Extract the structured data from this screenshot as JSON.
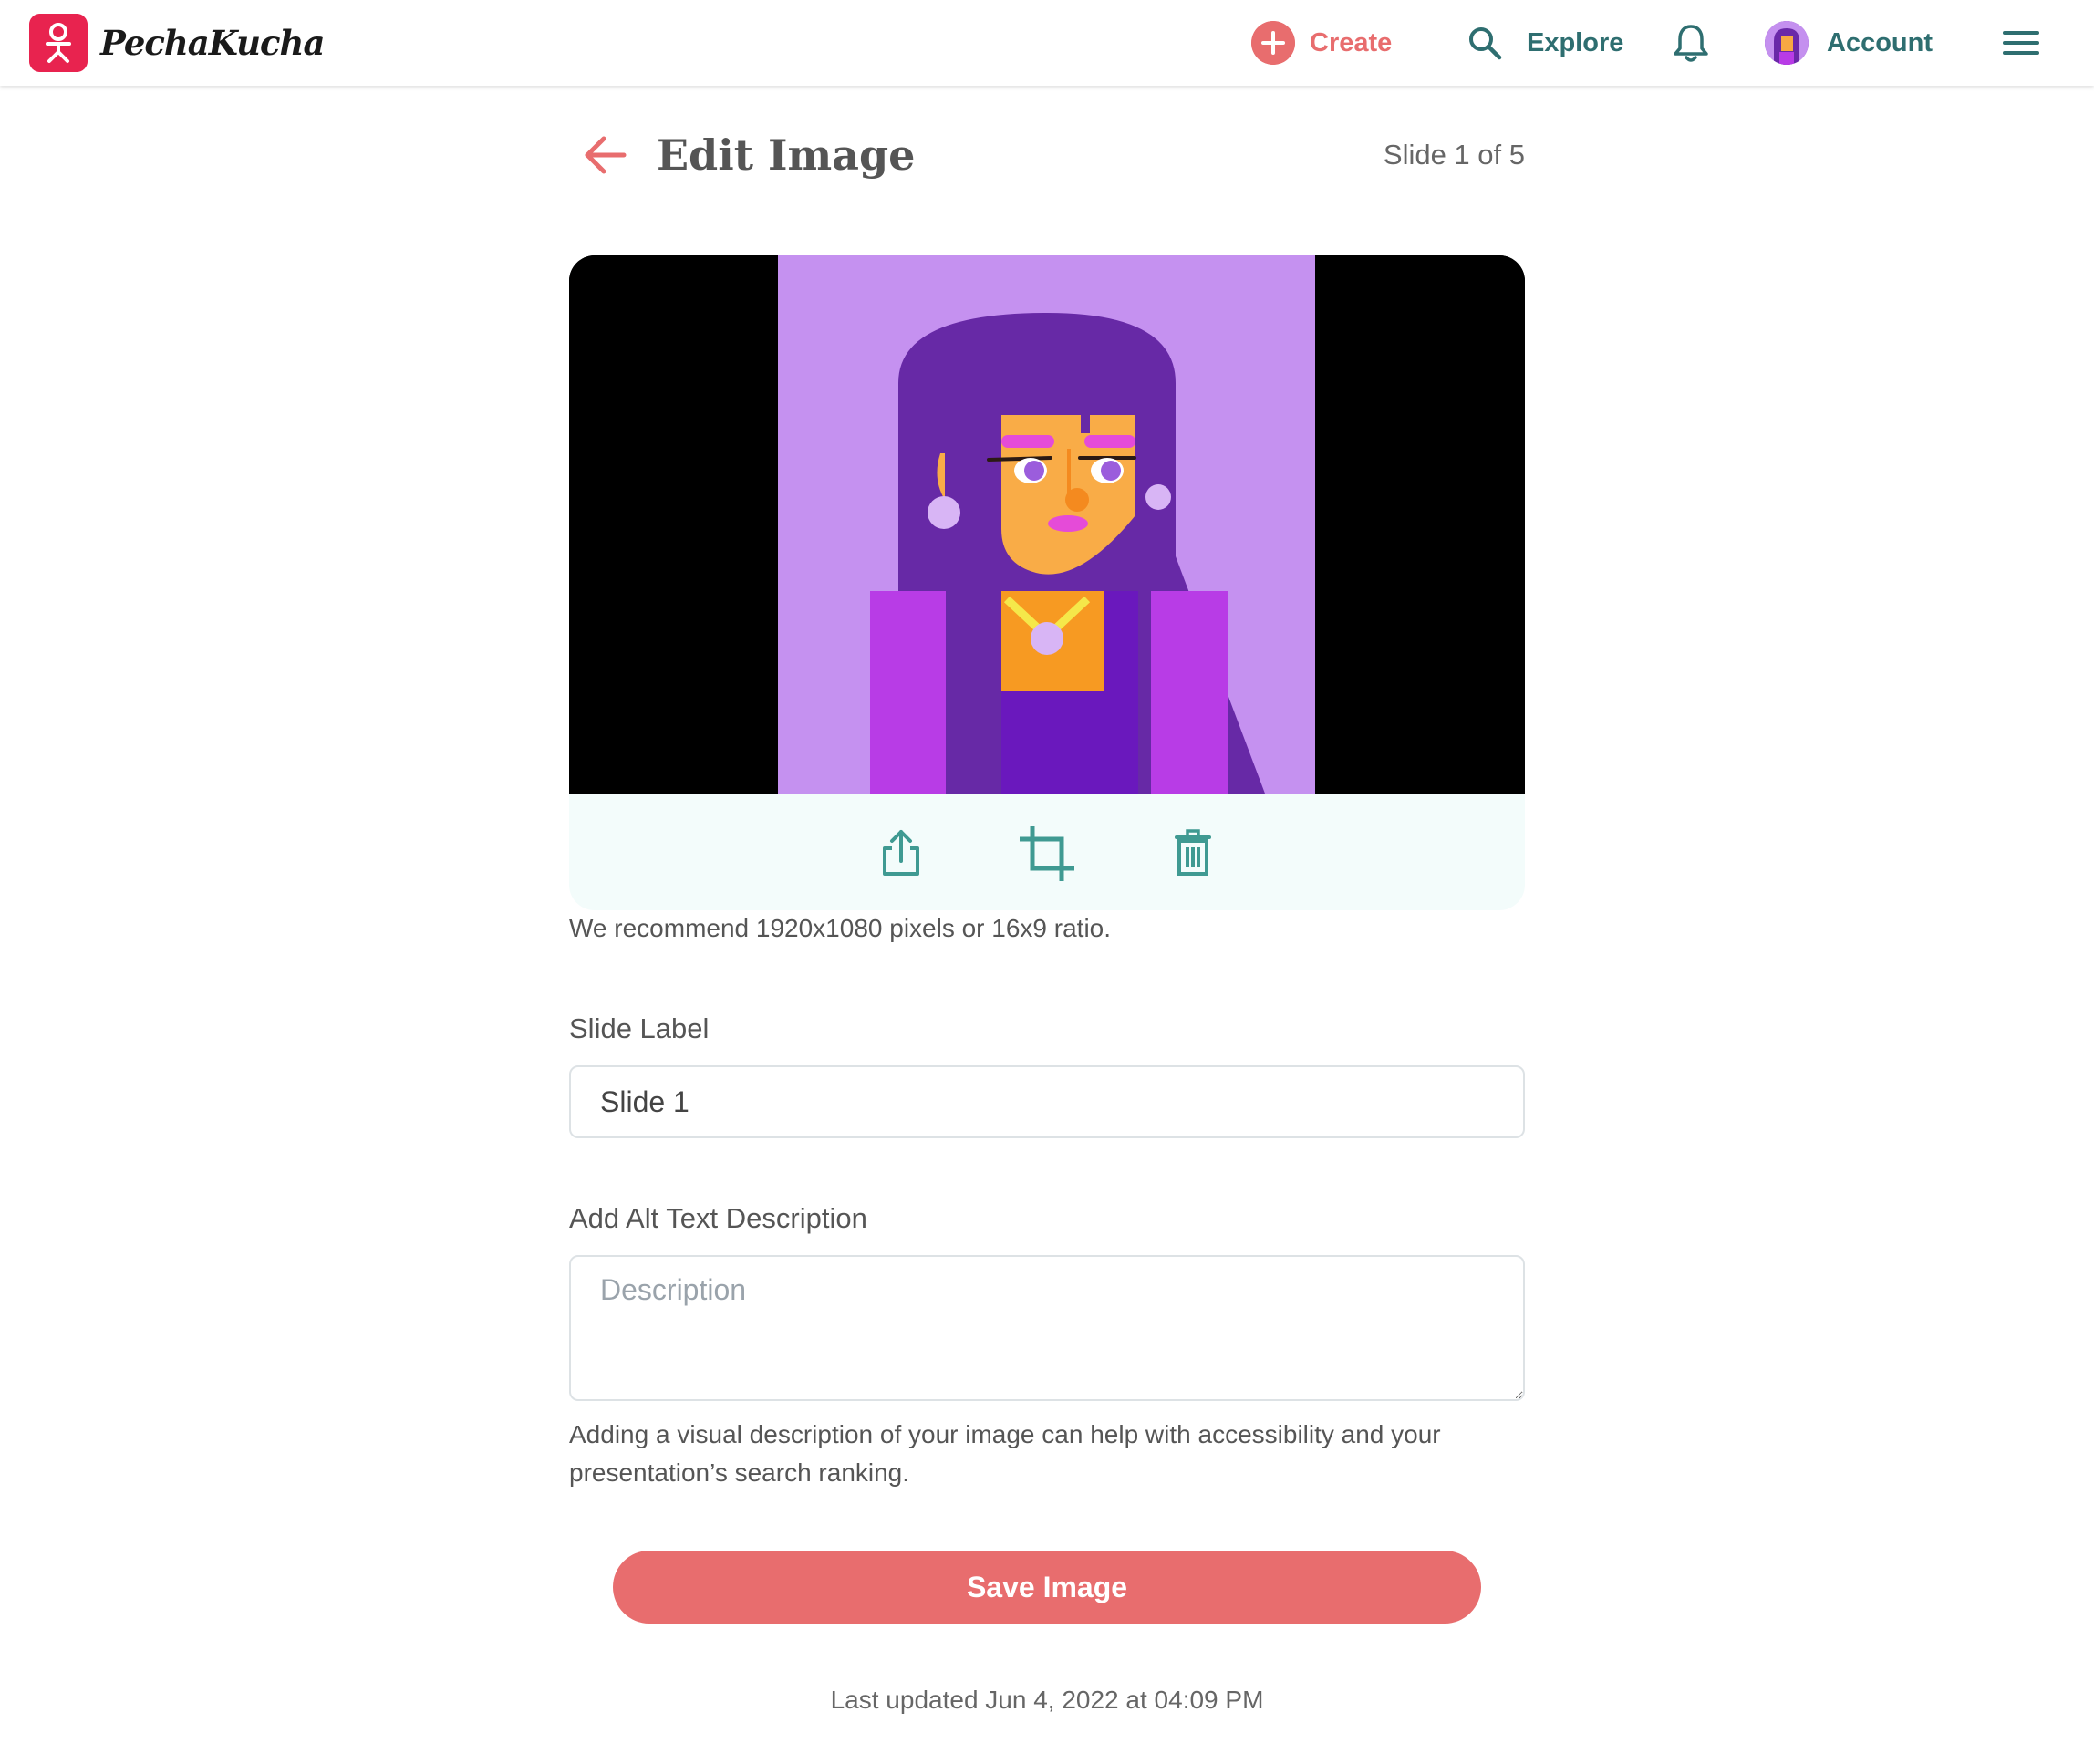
{
  "app": {
    "name": "PechaKucha"
  },
  "nav": {
    "create_label": "Create",
    "explore_label": "Explore",
    "account_label": "Account"
  },
  "header": {
    "title": "Edit Image",
    "slide_counter": "Slide 1 of 5"
  },
  "image": {
    "recommendation": "We recommend 1920x1080 pixels or 16x9 ratio."
  },
  "form": {
    "slide_label_heading": "Slide Label",
    "slide_label_value": "Slide 1",
    "alt_heading": "Add Alt Text Description",
    "alt_placeholder": "Description",
    "alt_value": "",
    "alt_help": "Adding a visual description of your image can help with accessibility and your presentation’s search ranking."
  },
  "actions": {
    "save_label": "Save Image"
  },
  "footer": {
    "last_updated": "Last updated Jun 4, 2022 at 04:09 PM"
  },
  "colors": {
    "brand": "#e8234f",
    "accent": "#e86d6e",
    "teal": "#2e6e70",
    "tool_bg": "#f3fcfb"
  }
}
